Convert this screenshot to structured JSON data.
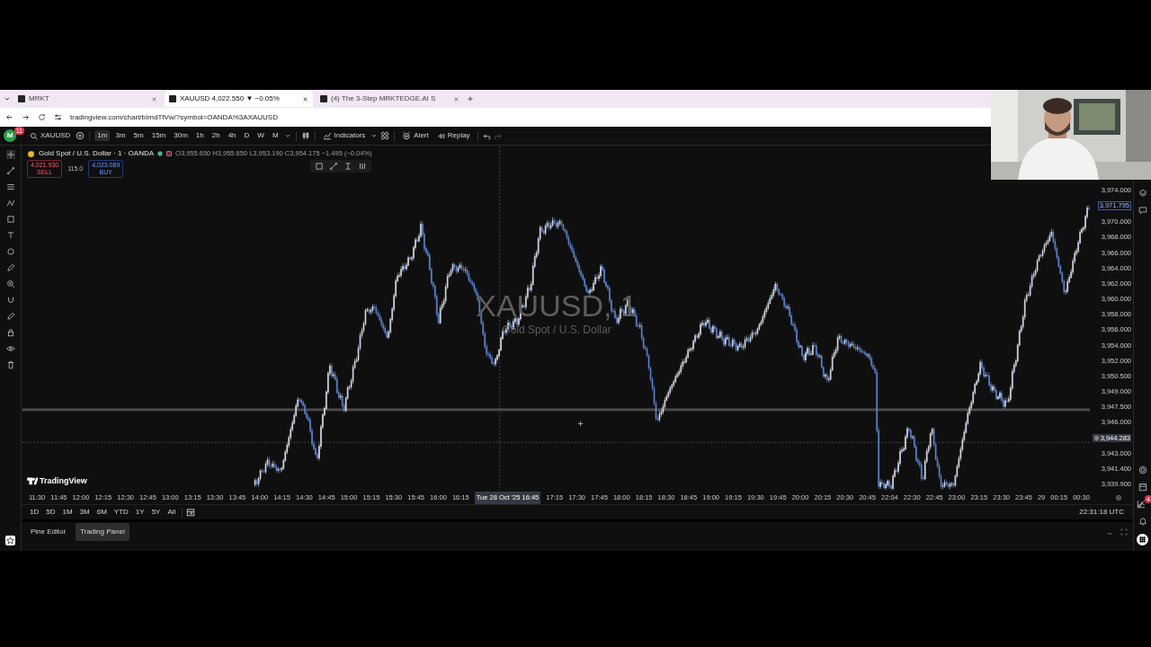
{
  "browser": {
    "tabs": [
      {
        "title": "MRKT",
        "selected": false
      },
      {
        "title": "XAUUSD 4,022.550 ▼ −0.05%",
        "selected": true
      },
      {
        "title": "(4) The 3-Step MRKTEDGE.AI S",
        "selected": false
      }
    ],
    "url": "tradingview.com/chart/bImdTfVw/?symbol=OANDA%3AXAUUSD"
  },
  "toolbar": {
    "avatar_letter": "M",
    "notification_count": "11",
    "symbol": "XAUUSD",
    "intervals": [
      {
        "label": "1m",
        "selected": true
      },
      {
        "label": "3m",
        "selected": false
      },
      {
        "label": "5m",
        "selected": false
      },
      {
        "label": "15m",
        "selected": false
      },
      {
        "label": "30m",
        "selected": false
      },
      {
        "label": "1h",
        "selected": false
      },
      {
        "label": "2h",
        "selected": false
      },
      {
        "label": "4h",
        "selected": false
      },
      {
        "label": "D",
        "selected": false
      },
      {
        "label": "W",
        "selected": false
      },
      {
        "label": "M",
        "selected": false
      }
    ],
    "indicators": "Indicators",
    "alert": "Alert",
    "replay": "Replay"
  },
  "legend": {
    "title": "Gold Spot / U.S. Dollar · 1 · OANDA",
    "ohlc": "O3,955.650 H3,955.650 L3,953.190 C3,954.175 −1.495 (−0.04%)",
    "sell": {
      "price": "4,021.930",
      "label": "SELL"
    },
    "spread": "115.0",
    "buy": {
      "price": "4,023.089",
      "label": "BUY"
    }
  },
  "watermark": {
    "symbol": "XAUUSD, 1",
    "description": "Gold Spot / U.S. Dollar"
  },
  "logo": "TradingView",
  "price_axis": [
    {
      "kind": "tick",
      "label": "3,974.000"
    },
    {
      "kind": "last",
      "label": "3,971.795"
    },
    {
      "kind": "tick",
      "label": "3,970.000"
    },
    {
      "kind": "tick",
      "label": "3,968.000"
    },
    {
      "kind": "tick",
      "label": "3,966.000"
    },
    {
      "kind": "tick",
      "label": "3,964.000"
    },
    {
      "kind": "tick",
      "label": "3,962.000"
    },
    {
      "kind": "tick",
      "label": "3,960.000"
    },
    {
      "kind": "tick",
      "label": "3,958.000"
    },
    {
      "kind": "tick",
      "label": "3,956.000"
    },
    {
      "kind": "tick",
      "label": "3,954.000"
    },
    {
      "kind": "tick",
      "label": "3,952.000"
    },
    {
      "kind": "tick",
      "label": "3,950.500"
    },
    {
      "kind": "tick",
      "label": "3,949.000"
    },
    {
      "kind": "tick",
      "label": "3,947.500"
    },
    {
      "kind": "tick",
      "label": "3,946.000"
    },
    {
      "kind": "crosshair",
      "label": "3,944.283"
    },
    {
      "kind": "tick",
      "label": "3,943.000"
    },
    {
      "kind": "tick",
      "label": "3,941.400"
    },
    {
      "kind": "tick",
      "label": "3,939.900"
    }
  ],
  "time_axis": [
    {
      "kind": "tick",
      "label": "11:30"
    },
    {
      "kind": "tick",
      "label": "11:45"
    },
    {
      "kind": "tick",
      "label": "12:00"
    },
    {
      "kind": "tick",
      "label": "12:15"
    },
    {
      "kind": "tick",
      "label": "12:30"
    },
    {
      "kind": "tick",
      "label": "12:45"
    },
    {
      "kind": "tick",
      "label": "13:00"
    },
    {
      "kind": "tick",
      "label": "13:15"
    },
    {
      "kind": "tick",
      "label": "13:30"
    },
    {
      "kind": "tick",
      "label": "13:45"
    },
    {
      "kind": "tick",
      "label": "14:00"
    },
    {
      "kind": "tick",
      "label": "14:15"
    },
    {
      "kind": "tick",
      "label": "14:30"
    },
    {
      "kind": "tick",
      "label": "14:45"
    },
    {
      "kind": "tick",
      "label": "15:00"
    },
    {
      "kind": "tick",
      "label": "15:15"
    },
    {
      "kind": "tick",
      "label": "15:30"
    },
    {
      "kind": "tick",
      "label": "15:45"
    },
    {
      "kind": "tick",
      "label": "16:00"
    },
    {
      "kind": "tick",
      "label": "16:15"
    },
    {
      "kind": "crosshair",
      "label": "Tue 28 Oct '25  16:45"
    },
    {
      "kind": "tick",
      "label": "17:15"
    },
    {
      "kind": "tick",
      "label": "17:30"
    },
    {
      "kind": "tick",
      "label": "17:45"
    },
    {
      "kind": "tick",
      "label": "18:00"
    },
    {
      "kind": "tick",
      "label": "18:15"
    },
    {
      "kind": "tick",
      "label": "18:30"
    },
    {
      "kind": "tick",
      "label": "18:45"
    },
    {
      "kind": "tick",
      "label": "19:00"
    },
    {
      "kind": "tick",
      "label": "19:15"
    },
    {
      "kind": "tick",
      "label": "19:30"
    },
    {
      "kind": "tick",
      "label": "19:45"
    },
    {
      "kind": "tick",
      "label": "20:00"
    },
    {
      "kind": "tick",
      "label": "20:15"
    },
    {
      "kind": "tick",
      "label": "20:30"
    },
    {
      "kind": "tick",
      "label": "20:45"
    },
    {
      "kind": "tick",
      "label": "22:04"
    },
    {
      "kind": "tick",
      "label": "22:30"
    },
    {
      "kind": "tick",
      "label": "22:45"
    },
    {
      "kind": "tick",
      "label": "23:00"
    },
    {
      "kind": "tick",
      "label": "23:15"
    },
    {
      "kind": "tick",
      "label": "23:30"
    },
    {
      "kind": "tick",
      "label": "23:45"
    },
    {
      "kind": "tick",
      "label": "29"
    },
    {
      "kind": "tick",
      "label": "00:15"
    },
    {
      "kind": "tick",
      "label": "00:30"
    }
  ],
  "ranges": [
    "1D",
    "5D",
    "1M",
    "3M",
    "6M",
    "YTD",
    "1Y",
    "5Y",
    "All"
  ],
  "clock": "22:31:18 UTC",
  "panel_tabs": [
    {
      "label": "Pine Editor",
      "selected": false
    },
    {
      "label": "Trading Panel",
      "selected": true
    }
  ],
  "right_toolbar": {
    "badge": "4"
  }
}
